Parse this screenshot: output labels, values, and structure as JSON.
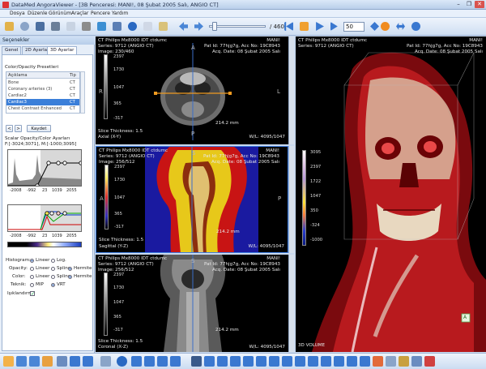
{
  "window": {
    "title": "DataMed AngoraViewer - [3B Penceresi: MANI!, 08 Şubat 2005 Salı, ANGIO CT]",
    "buttons": [
      "–",
      "❐",
      "✕"
    ]
  },
  "menu": [
    "Dosya",
    "Düzenle",
    "Görünüm",
    "Araçlar",
    "Pencere",
    "Yardım"
  ],
  "toolbar": {
    "frame_label": "/ 460",
    "fps_value": "50"
  },
  "left_panel": {
    "header": "Seçenekler",
    "tabs": [
      "Genel",
      "2D Ayarlar",
      "3D Ayarlar"
    ],
    "active_tab": "3D Ayarlar",
    "presets_title": "Color/Opacity Presetleri",
    "table_headers": [
      "Açıklama",
      "Tip"
    ],
    "presets": [
      {
        "name": "Bone",
        "type": "CT"
      },
      {
        "name": "Coronary arteries (3)",
        "type": "CT"
      },
      {
        "name": "Cardiac2",
        "type": "CT"
      },
      {
        "name": "Cardiac3",
        "type": "CT"
      },
      {
        "name": "Chest Contrast Enhanced",
        "type": "CT"
      }
    ],
    "selected_preset": "Cardiac3",
    "nav_prev": "<",
    "nav_next": ">",
    "save_label": "Kaydet",
    "scalar_title": "Scalar Opacity/Color Ayarları",
    "range_text": "F:[-3024;3071], M:[-1000;3095]",
    "graph1_ticks": [
      "-2008",
      "-992",
      "23",
      "1039",
      "2055"
    ],
    "graph2_ticks": [
      "-2008",
      "-992",
      "23",
      "1039",
      "2055"
    ],
    "options": [
      {
        "label": "Histogram:",
        "a": "Lineer",
        "b": "Log."
      },
      {
        "label": "Opacity:",
        "a": "Lineer",
        "b": "Spline",
        "c": "Hermite"
      },
      {
        "label": "Color:",
        "a": "Lineer",
        "b": "Spline",
        "c": "Hermite"
      },
      {
        "label": "Teknik:",
        "a": "MIP",
        "b": "VRT"
      }
    ],
    "lighting_label": "Işıklandırma"
  },
  "viewports": {
    "axial": {
      "header_left": "CT Philips Mx8000 IDT ctdumc",
      "header_right": "MANI!",
      "series": "Series: 9712 (ANGIO CT)",
      "image": "Image: 230/460",
      "pat_id": "Pat Id: 77hjg7g, Acc No: 19C8943",
      "acq": "Acq. Date: 08 Şubat 2005 Salı",
      "slice": "Slice Thickness: 1.5",
      "orientation": "Axial (X-Y)",
      "wl": "W/L: 4095/1047",
      "scale": "214.2 mm",
      "letters": [
        "A",
        "R",
        "L",
        "P"
      ],
      "lut": [
        "3095",
        "2397",
        "1730",
        "1047",
        "365",
        "-317",
        "-1000"
      ]
    },
    "sagittal": {
      "header_left": "CT Philips Mx8000 IDT ctdumc",
      "header_right": "MANI!",
      "series": "Series: 9712 (ANGIO CT)",
      "image": "Image: 256/512",
      "pat_id": "Pat Id: 77hjg7g, Acc No: 19C8943",
      "acq": "Acq. Date: 08 Şubat 2005 Salı",
      "slice": "Slice Thickness: 1.5",
      "orientation": "Sagittal (Y-Z)",
      "wl": "W/L: 4095/1047",
      "scale": "214.2 mm",
      "letters": [
        "S",
        "A",
        "P",
        "I"
      ],
      "lut": [
        "3095",
        "2397",
        "1730",
        "1047",
        "365",
        "-317",
        "-1000"
      ]
    },
    "coronal": {
      "header_left": "CT Philips Mx8000 IDT ctdumc",
      "header_right": "MANI!",
      "series": "Series: 9712 (ANGIO CT)",
      "image": "Image: 256/512",
      "pat_id": "Pat Id: 77hjg7g, Acc No: 19C8943",
      "acq": "Acq. Date: 08 Şubat 2005 Salı",
      "slice": "Slice Thickness: 1.5",
      "orientation": "Coronal (X-Z)",
      "wl": "W/L: 4095/1047",
      "scale": "214.2 mm",
      "letters": [
        "S",
        "R",
        "L",
        "I"
      ],
      "lut": [
        "3095",
        "2397",
        "1730",
        "1047",
        "365",
        "-317",
        "-1000"
      ]
    },
    "volume": {
      "header_left": "CT Philips Mx8000 IDT ctdumc",
      "header_right": "MANI!",
      "series": "Series: 9712 (ANGIO CT)",
      "pat_id": "Pat Id: 77hjg7g, Acc No: 19C8943",
      "acq": "Acq. Date: 08 Şubat 2005 Salı",
      "label": "3D VOLUME",
      "lut": [
        "3095",
        "2397",
        "1722",
        "1047",
        "350",
        "-324",
        "-1000"
      ],
      "cube_label": "A"
    }
  },
  "colors": {
    "accent": "#3d7de0",
    "selection": "#3b7fd9",
    "orange_line": "#f09a20"
  }
}
